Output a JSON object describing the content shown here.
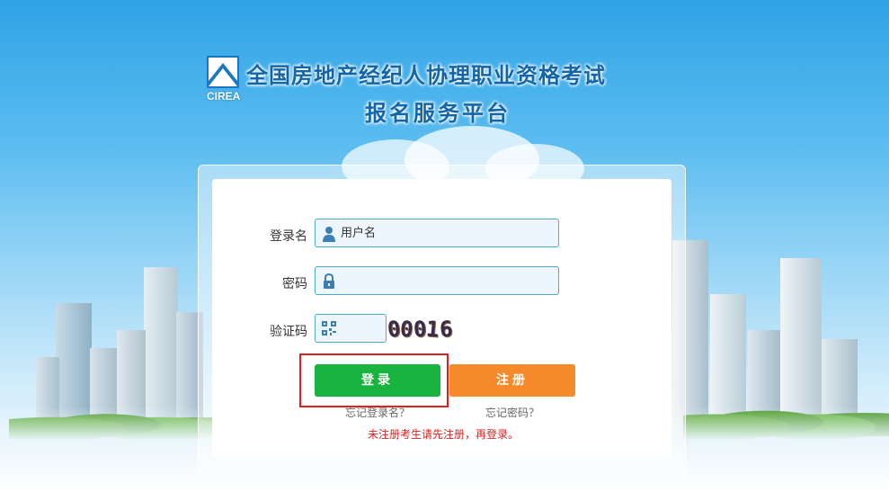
{
  "header": {
    "logo_text": "CIREA",
    "title_line1": "全国房地产经纪人协理职业资格考试",
    "title_line2": "报名服务平台"
  },
  "form": {
    "username_label": "登录名",
    "username_placeholder": "用户名",
    "password_label": "密码",
    "password_placeholder": "",
    "captcha_label": "验证码",
    "captcha_value": "",
    "captcha_image_text": [
      "0",
      "0",
      "0",
      "1",
      "6"
    ]
  },
  "buttons": {
    "login": "登录",
    "register": "注册"
  },
  "links": {
    "forgot_username": "忘记登录名？",
    "forgot_password": "忘记密码？"
  },
  "notice": "未注册考生请先注册，再登录。",
  "colors": {
    "login_button": "#19b43f",
    "register_button": "#f6892a",
    "title": "#1265a8",
    "notice": "#dd2222",
    "highlight_box": "#e02020"
  }
}
